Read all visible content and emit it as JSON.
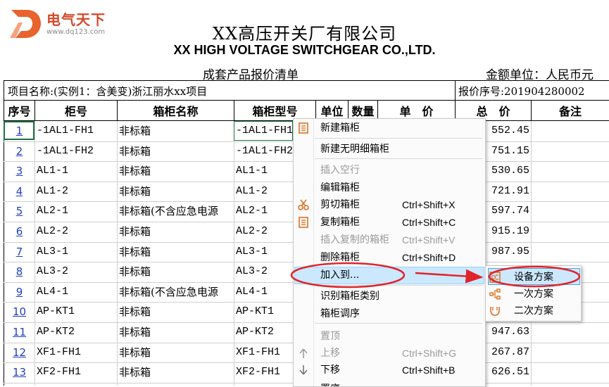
{
  "logo": {
    "site_name": "电气天下",
    "site_url": "www.dq123.com",
    "letter": "D"
  },
  "document": {
    "title_cn": "XX高压开关厂有限公司",
    "title_en": "XX HIGH VOLTAGE SWITCHGEAR CO.,LTD.",
    "subtitle": "成套产品报价清单",
    "currency_label": "金额单位：人民币元",
    "project_label": "项目名称:(实例1：含美变)浙江丽水xx项目",
    "quote_no_label": "报价序号:201904280002"
  },
  "table": {
    "headers": [
      "序号",
      "柜号",
      "箱柜名称",
      "箱柜型号",
      "单位",
      "数量",
      "单　价",
      "总　价",
      "备注"
    ],
    "rows": [
      {
        "seq": "1",
        "cabinet_no": "-1AL1-FH1",
        "name": "非标箱",
        "model": "-1AL1-FH1",
        "total": "552.45"
      },
      {
        "seq": "2",
        "cabinet_no": "-1AL1-FH2",
        "name": "非标箱",
        "model": "-1AL1-FH2",
        "total": "751.15"
      },
      {
        "seq": "3",
        "cabinet_no": "AL1-1",
        "name": "非标箱",
        "model": "AL1-1",
        "total": "530.65"
      },
      {
        "seq": "4",
        "cabinet_no": "AL1-2",
        "name": "非标箱",
        "model": "AL1-2",
        "total": "721.91"
      },
      {
        "seq": "5",
        "cabinet_no": "AL2-1",
        "name": "非标箱(不含应急电源",
        "model": "AL2-1",
        "total": "597.74"
      },
      {
        "seq": "6",
        "cabinet_no": "AL2-2",
        "name": "非标箱",
        "model": "AL2-2",
        "total": "915.19"
      },
      {
        "seq": "7",
        "cabinet_no": "AL3-1",
        "name": "非标箱",
        "model": "AL3-1",
        "total": "987.95"
      },
      {
        "seq": "8",
        "cabinet_no": "AL3-2",
        "name": "非标箱",
        "model": "AL3-2",
        "total": ""
      },
      {
        "seq": "9",
        "cabinet_no": "AL4-1",
        "name": "非标箱(不含应急电源",
        "model": "AL4-1",
        "total": ""
      },
      {
        "seq": "10",
        "cabinet_no": "AP-KT1",
        "name": "非标箱",
        "model": "AP-KT1",
        "total": ""
      },
      {
        "seq": "11",
        "cabinet_no": "AP-KT2",
        "name": "非标箱",
        "model": "AP-KT2",
        "total": "947.63"
      },
      {
        "seq": "12",
        "cabinet_no": "XF1-FH1",
        "name": "非标箱",
        "model": "XF1-FH1",
        "total": "267.87"
      },
      {
        "seq": "13",
        "cabinet_no": "XF2-FH1",
        "name": "非标箱",
        "model": "XF2-FH1",
        "total": "626.51"
      }
    ]
  },
  "context_menu": {
    "items": [
      {
        "label": "新建箱柜",
        "shortcut": "",
        "icon": "new-cabinet-icon",
        "disabled": false
      },
      {
        "label": "新建无明细箱柜",
        "shortcut": "",
        "icon": "",
        "disabled": false
      },
      {
        "label": "插入空行",
        "shortcut": "",
        "icon": "",
        "disabled": true
      },
      {
        "label": "编辑箱柜",
        "shortcut": "",
        "icon": "",
        "disabled": false
      },
      {
        "label": "剪切箱柜",
        "shortcut": "Ctrl+Shift+X",
        "icon": "scissors-icon",
        "disabled": false
      },
      {
        "label": "复制箱柜",
        "shortcut": "Ctrl+Shift+C",
        "icon": "copy-icon",
        "disabled": false
      },
      {
        "label": "插入复制的箱柜",
        "shortcut": "Ctrl+Shift+V",
        "icon": "",
        "disabled": true
      },
      {
        "label": "删除箱柜",
        "shortcut": "Ctrl+Shift+D",
        "icon": "",
        "disabled": false
      },
      {
        "label": "加入到...",
        "shortcut": "",
        "icon": "",
        "disabled": false
      },
      {
        "label": "识别箱柜类别",
        "shortcut": "",
        "icon": "",
        "disabled": false
      },
      {
        "label": "箱柜调序",
        "shortcut": "",
        "icon": "",
        "disabled": false
      },
      {
        "label": "置顶",
        "shortcut": "",
        "icon": "",
        "disabled": true
      },
      {
        "label": "上移",
        "shortcut": "Ctrl+Shift+G",
        "icon": "arrow-up-icon",
        "disabled": true
      },
      {
        "label": "下移",
        "shortcut": "Ctrl+Shift+B",
        "icon": "arrow-down-icon",
        "disabled": false
      },
      {
        "label": "置底",
        "shortcut": "",
        "icon": "",
        "disabled": false
      }
    ]
  },
  "submenu": {
    "items": [
      {
        "label": "设备方案",
        "icon": "equipment-scheme-icon"
      },
      {
        "label": "一次方案",
        "icon": "primary-scheme-icon"
      },
      {
        "label": "二次方案",
        "icon": "secondary-scheme-icon"
      }
    ]
  },
  "colors": {
    "annotation": "#e0242a",
    "highlight": "#cce8ff",
    "link": "#1f3fbf",
    "icon_orange": "#e07020"
  }
}
